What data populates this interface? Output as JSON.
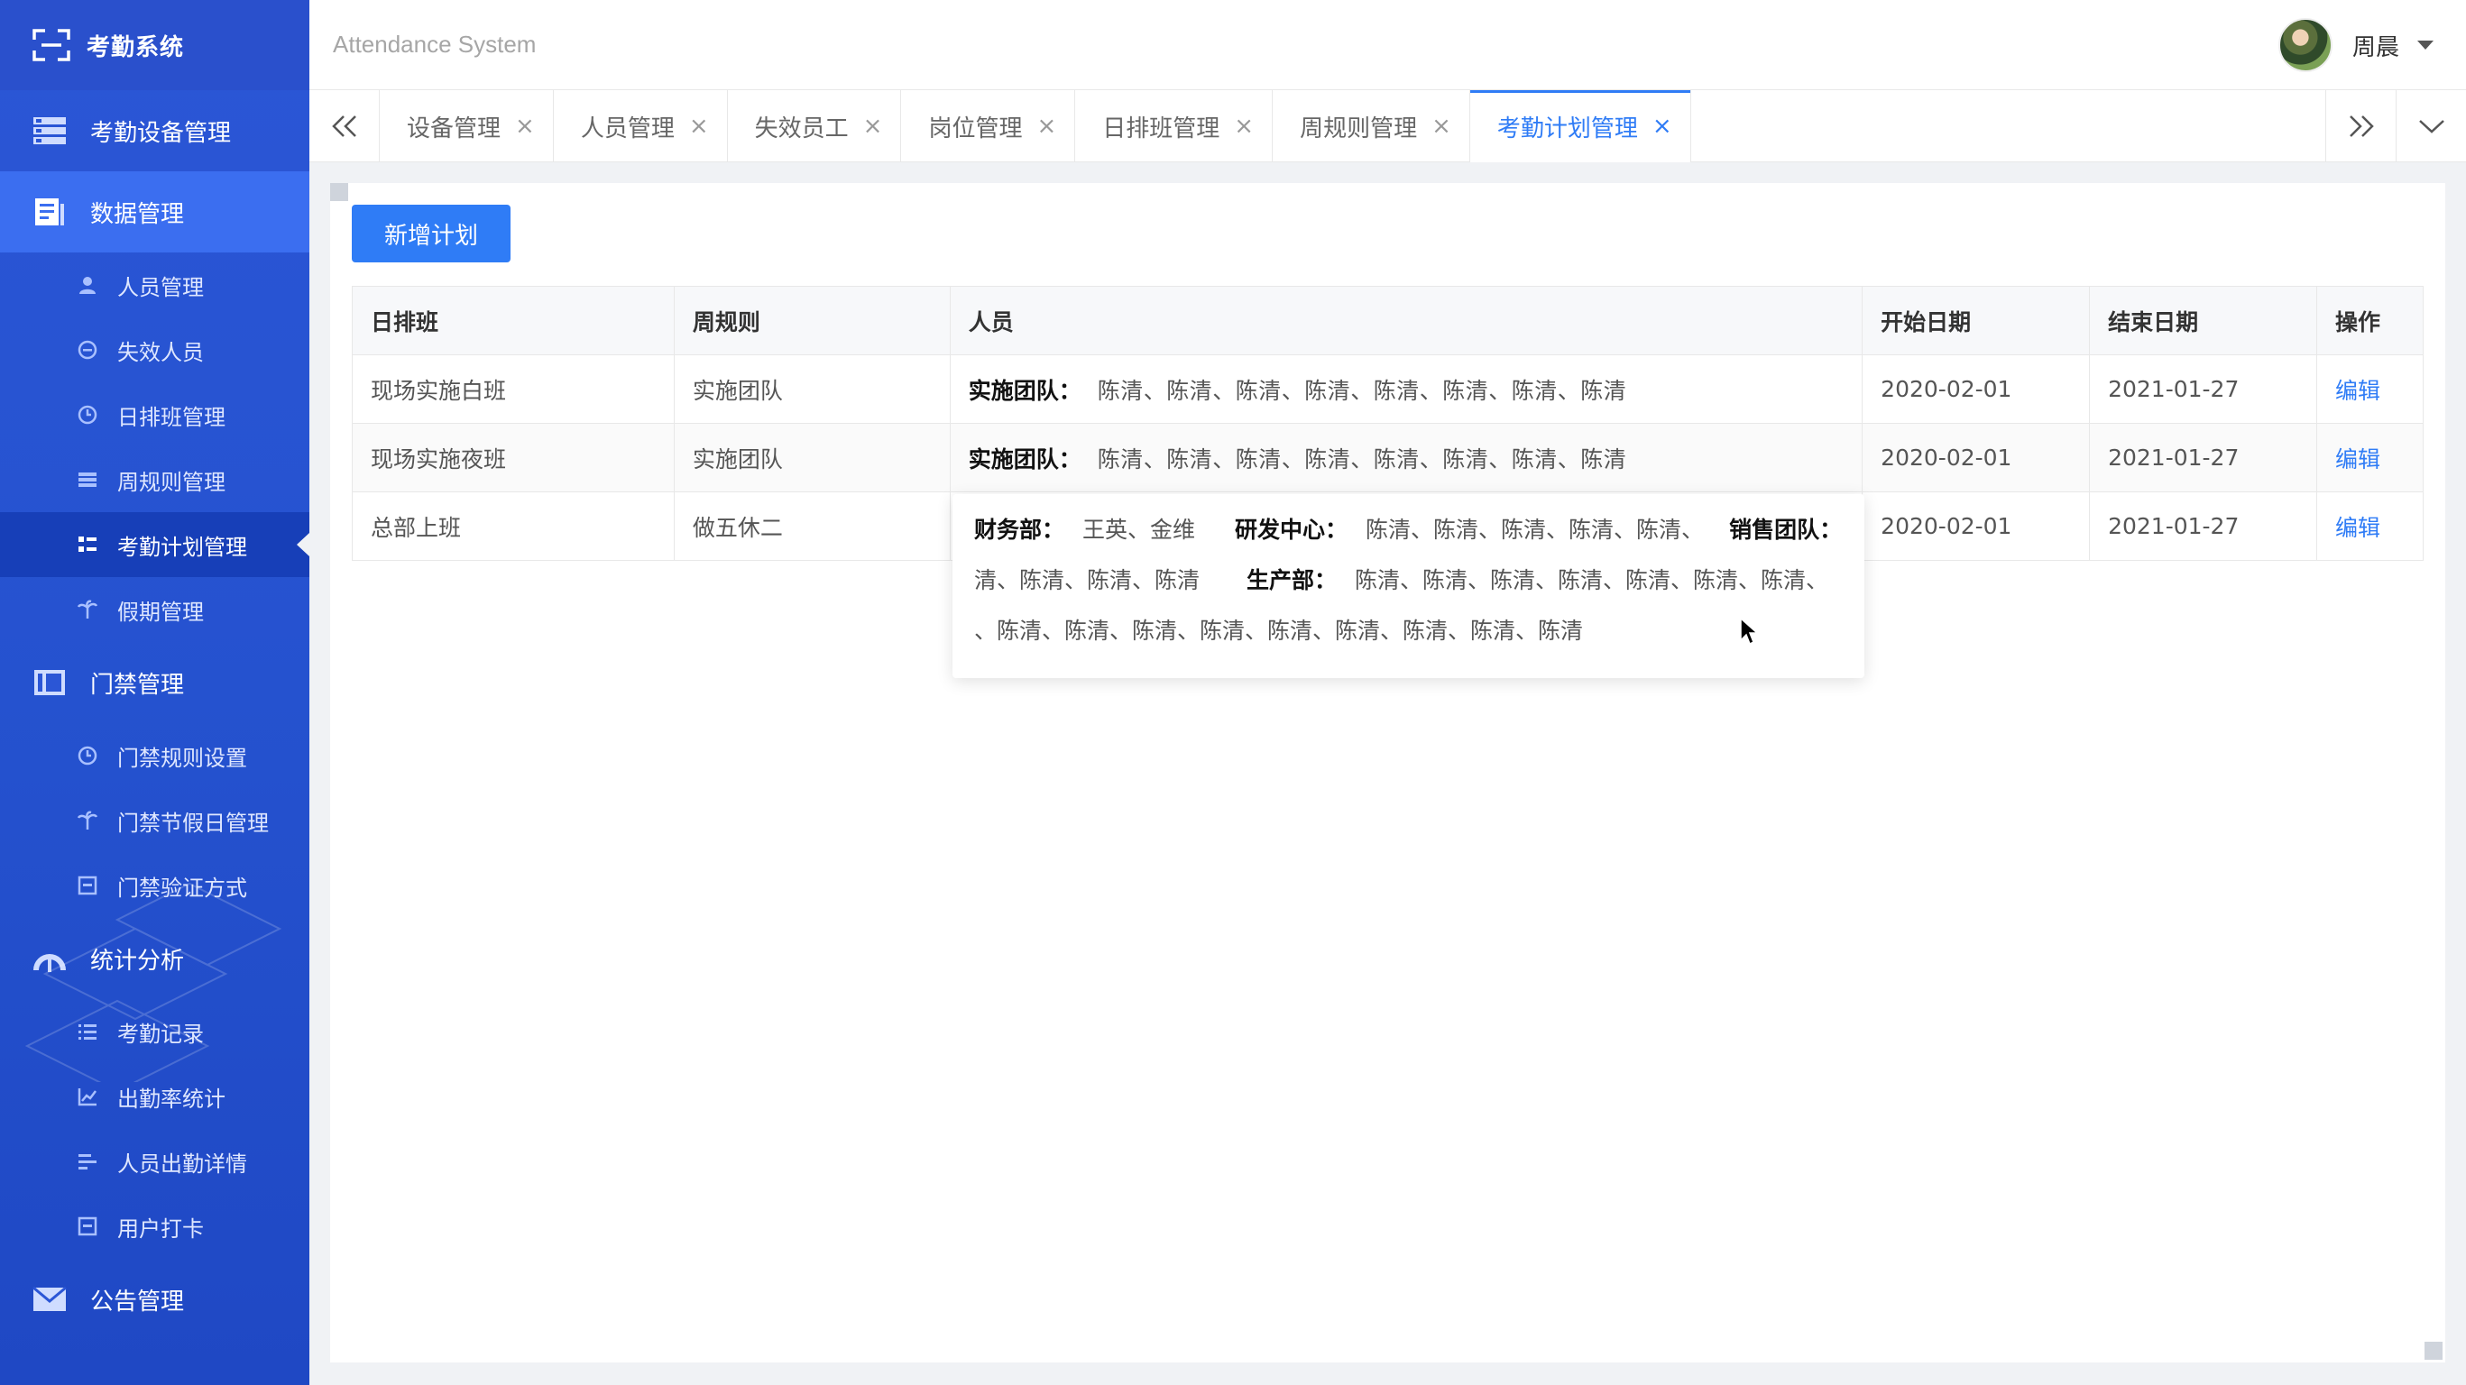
{
  "app": {
    "title": "考勤系统",
    "subtitle": "Attendance System"
  },
  "user": {
    "name": "周晨"
  },
  "sidebar": {
    "groups": [
      {
        "label": "考勤设备管理",
        "icon": "server-icon"
      },
      {
        "label": "数据管理",
        "icon": "document-icon",
        "active": true,
        "items": [
          {
            "label": "人员管理",
            "icon": "person-icon"
          },
          {
            "label": "失效人员",
            "icon": "minus-circle-icon"
          },
          {
            "label": "日排班管理",
            "icon": "clock-icon"
          },
          {
            "label": "周规则管理",
            "icon": "list-icon"
          },
          {
            "label": "考勤计划管理",
            "icon": "plan-list-icon",
            "active": true
          },
          {
            "label": "假期管理",
            "icon": "palm-tree-icon"
          }
        ]
      },
      {
        "label": "门禁管理",
        "icon": "door-icon",
        "items": [
          {
            "label": "门禁规则设置",
            "icon": "clock-icon"
          },
          {
            "label": "门禁节假日管理",
            "icon": "palm-tree-icon"
          },
          {
            "label": "门禁验证方式",
            "icon": "card-icon"
          }
        ]
      },
      {
        "label": "统计分析",
        "icon": "gauge-icon",
        "items": [
          {
            "label": "考勤记录",
            "icon": "list-icon"
          },
          {
            "label": "出勤率统计",
            "icon": "chart-icon"
          },
          {
            "label": "人员出勤详情",
            "icon": "detail-icon"
          },
          {
            "label": "用户打卡",
            "icon": "checkin-icon"
          }
        ]
      },
      {
        "label": "公告管理",
        "icon": "mail-icon"
      }
    ]
  },
  "tabs": [
    {
      "label": "设备管理"
    },
    {
      "label": "人员管理"
    },
    {
      "label": "失效员工"
    },
    {
      "label": "岗位管理"
    },
    {
      "label": "日排班管理"
    },
    {
      "label": "周规则管理"
    },
    {
      "label": "考勤计划管理",
      "active": true
    }
  ],
  "toolbar": {
    "add_label": "新增计划"
  },
  "table": {
    "headers": [
      "日排班",
      "周规则",
      "人员",
      "开始日期",
      "结束日期",
      "操作"
    ],
    "rows": [
      {
        "shift": "现场实施白班",
        "rule": "实施团队",
        "team": "实施团队：",
        "names": "陈清、陈清、陈清、陈清、陈清、陈清、陈清、陈清",
        "start": "2020-02-01",
        "end": "2021-01-27",
        "action": "编辑"
      },
      {
        "shift": "现场实施夜班",
        "rule": "实施团队",
        "team": "实施团队：",
        "names": "陈清、陈清、陈清、陈清、陈清、陈清、陈清、陈清",
        "start": "2020-02-01",
        "end": "2021-01-27",
        "action": "编辑"
      },
      {
        "shift": "总部上班",
        "rule": "做五休二",
        "team": "",
        "names": "",
        "start": "2020-02-01",
        "end": "2021-01-27",
        "action": "编辑"
      }
    ]
  },
  "popover": {
    "line1": {
      "dep1": "财务部：",
      "names1": "王英、金维",
      "dep2": "研发中心：",
      "names2": "陈清、陈清、陈清、陈清、陈清、",
      "dep3": "销售团队："
    },
    "line2": {
      "names0": "清、陈清、陈清、陈清",
      "dep4": "生产部：",
      "names4": "陈清、陈清、陈清、陈清、陈清、陈清、陈清、"
    },
    "line3": {
      "names5": "、陈清、陈清、陈清、陈清、陈清、陈清、陈清、陈清、陈清"
    }
  },
  "colors": {
    "sidebar_bg": "#2b56d6",
    "accent": "#2f7cf6",
    "active_sub_bg": "#173fb8"
  }
}
